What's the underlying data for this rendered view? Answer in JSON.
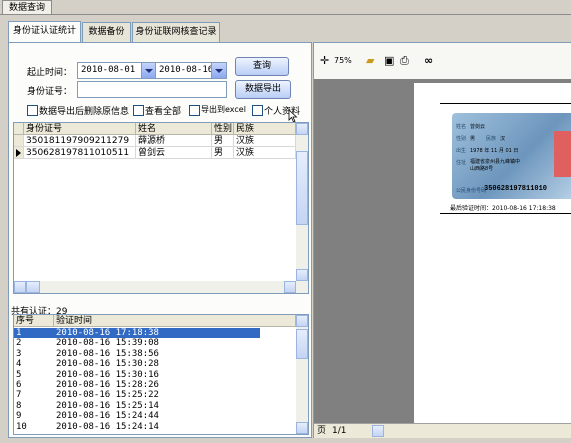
{
  "window": {
    "tab_label": "数据查询"
  },
  "tabs": [
    {
      "label": "身份证认证统计",
      "active": true
    },
    {
      "label": "数据备份",
      "active": false
    },
    {
      "label": "身份证联网核查记录",
      "active": false
    }
  ],
  "filters": {
    "start_time_label": "起止时间：",
    "start_date": "2010-08-01",
    "end_date": "2010-08-16",
    "id_label": "身份证号：",
    "id_value": ""
  },
  "buttons": {
    "query": "查询",
    "export": "数据导出"
  },
  "checkboxes": [
    {
      "label": "数据导出后删除原信息",
      "checked": false
    },
    {
      "label": "查看全部",
      "checked": false
    },
    {
      "label": "导出到excel",
      "checked": false
    },
    {
      "label": "个人资料",
      "checked": false
    }
  ],
  "results_table": {
    "headers": [
      "身份证号",
      "姓名",
      "性别",
      "民族"
    ],
    "rows": [
      [
        "350181197909211279",
        "薛源桥",
        "男",
        "汉族"
      ],
      [
        "350628197811010511",
        "曾剑云",
        "男",
        "汉族"
      ]
    ],
    "selected_row": 1
  },
  "summary": "共有认证：29",
  "log_table": {
    "headers": [
      "序号",
      "验证时间"
    ],
    "rows": [
      [
        "1",
        "2010-08-16 17:18:38"
      ],
      [
        "2",
        "2010-08-16 15:39:08"
      ],
      [
        "3",
        "2010-08-16 15:38:56"
      ],
      [
        "4",
        "2010-08-16 15:30:28"
      ],
      [
        "5",
        "2010-08-16 15:30:16"
      ],
      [
        "6",
        "2010-08-16 15:28:26"
      ],
      [
        "7",
        "2010-08-16 15:25:22"
      ],
      [
        "8",
        "2010-08-16 15:25:14"
      ],
      [
        "9",
        "2010-08-16 15:24:44"
      ],
      [
        "10",
        "2010-08-16 15:24:14"
      ]
    ],
    "selected_row": 0
  },
  "preview": {
    "zoom": "75%",
    "card": {
      "name_label": "姓名",
      "name": "曾剑云",
      "gender_label": "性别",
      "gender": "男",
      "ethnicity_label": "民族",
      "ethnicity": "汉",
      "birth_label": "出生",
      "birth": "1978 年 11 月 01 日",
      "address_label": "住址",
      "address": "福建省泉州县九峰镇中山西路8号",
      "id_label": "公民身份号码",
      "id_number": "350628197811010"
    },
    "last_verify": "最后验证时间：2010-08-16 17:18:38",
    "page_label": "页",
    "page": "1/1"
  },
  "colors": {
    "selection": "#316ac5",
    "card_blue": "#6d96bd",
    "card_red": "#e06060"
  }
}
